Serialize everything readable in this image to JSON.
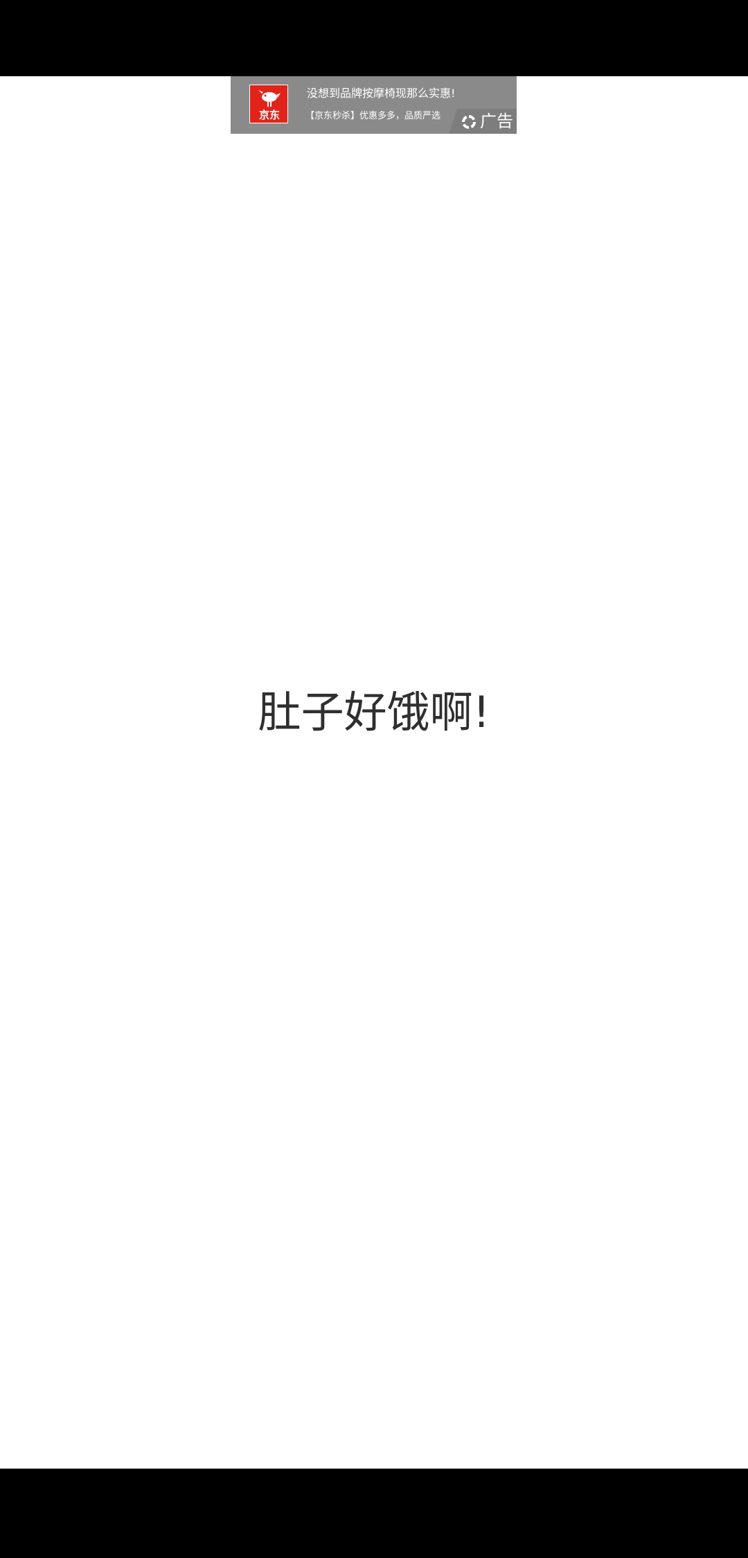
{
  "ad": {
    "logo_text": "京东",
    "title": "没想到品牌按摩椅现那么实惠!",
    "subtitle": "【京东秒杀】优惠多多，品质严选",
    "tag_label": "广告",
    "tag_icon": "ad-choices-icon",
    "brand_color": "#e2231a"
  },
  "main": {
    "message": "肚子好饿啊!"
  }
}
